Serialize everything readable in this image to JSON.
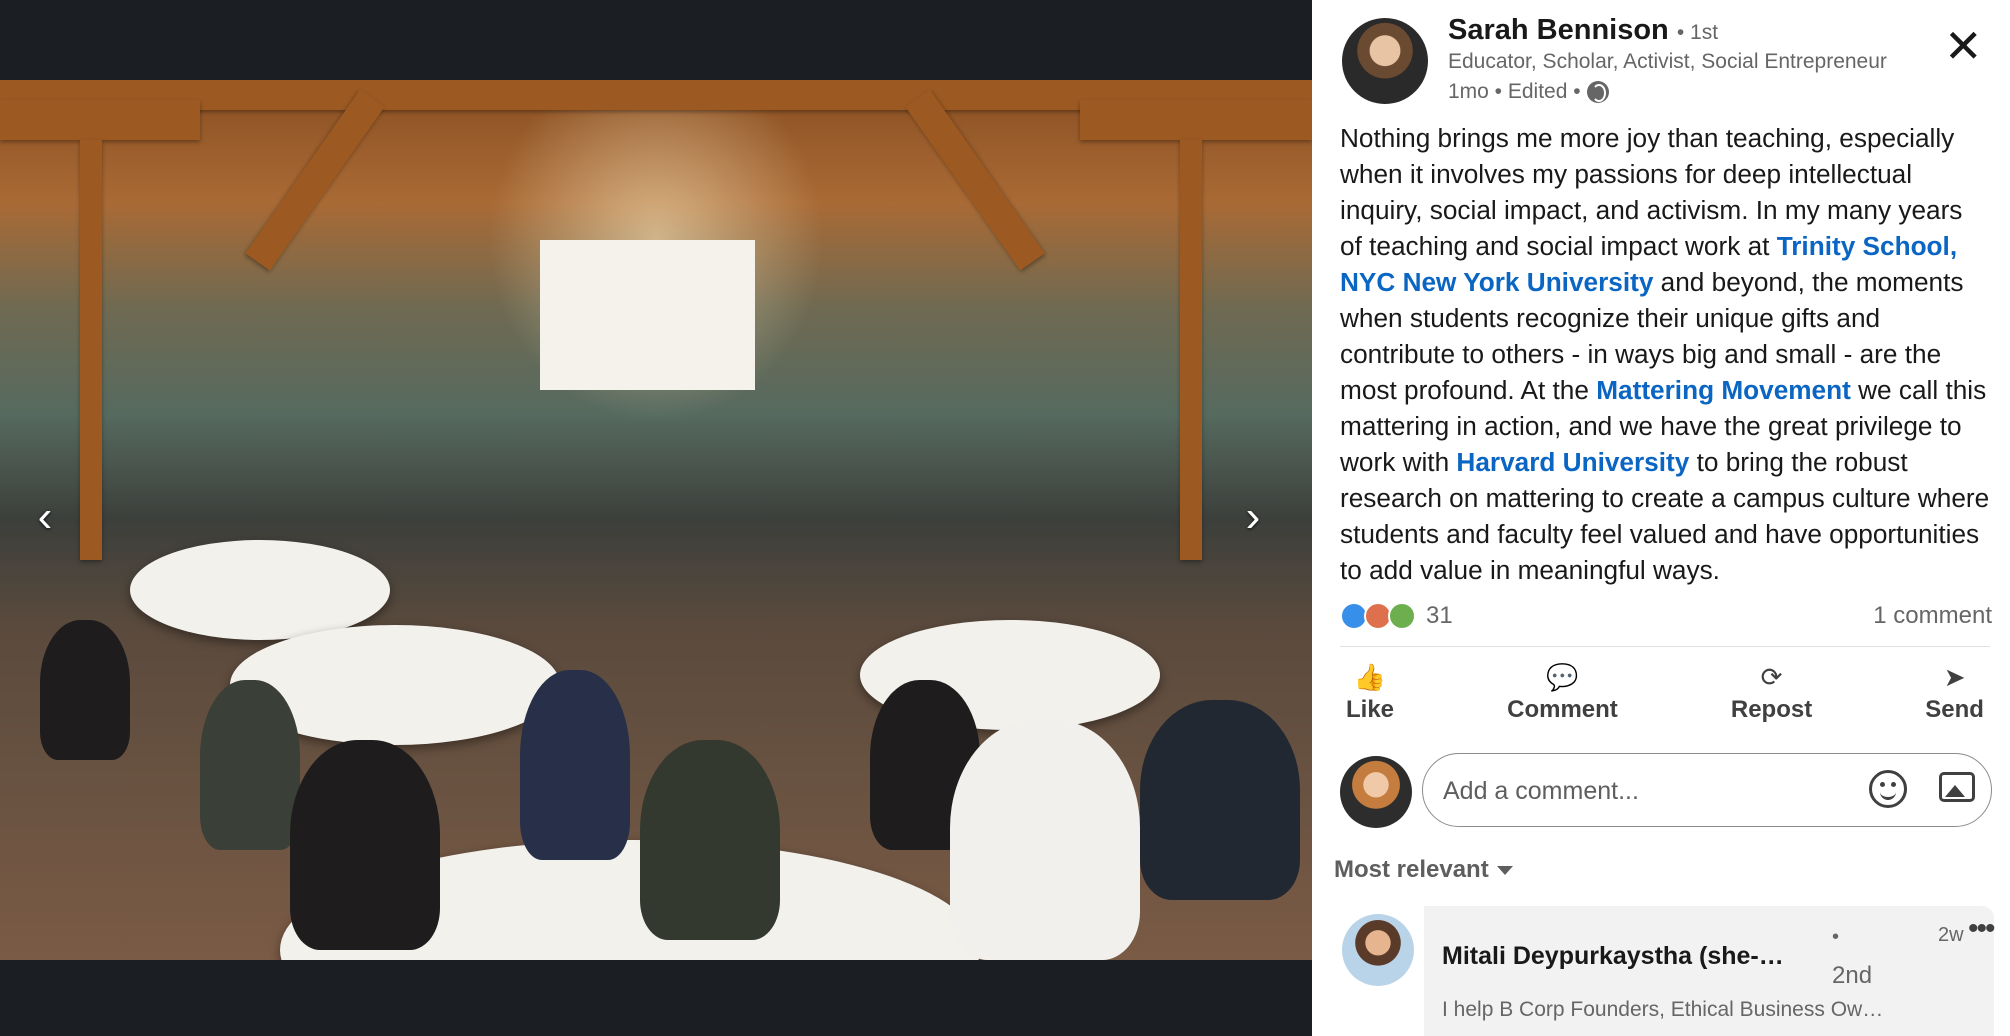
{
  "photo": {
    "prev_arrow": "‹",
    "next_arrow": "›"
  },
  "post": {
    "author": {
      "name": "Sarah Bennison",
      "degree": "• 1st",
      "headline": "Educator, Scholar, Activist, Social Entrepreneur",
      "meta": "1mo • Edited •"
    },
    "close_icon": "✕",
    "body": {
      "p1": "Nothing brings me more joy than teaching, especially when it involves my passions for deep intellectual inquiry, social impact, and activism. In my many years of teaching and social impact work at ",
      "link1": "Trinity School, NYC",
      "sep1": " ",
      "link2": "New York University",
      "p2": " and beyond, the moments when students recognize their unique gifts and contribute to others - in ways big and small - are the most profound. At the ",
      "link3": "Mattering Movement",
      "p3": " we call this mattering in action, and we have the great privilege to work with ",
      "link4": "Harvard University",
      "p4": " to bring the robust research on mattering to create a campus culture where students and faculty feel valued and have opportunities to add value in meaningful ways."
    },
    "reaction_count": "31",
    "comment_count": "1 comment",
    "actions": {
      "like": "Like",
      "comment": "Comment",
      "repost": "Repost",
      "send": "Send"
    },
    "comment_input": {
      "placeholder": "Add a comment..."
    },
    "sort_label": "Most relevant"
  },
  "comments": [
    {
      "name": "Mitali Deypurkaystha (she-…",
      "dot": "•",
      "degree": "2nd",
      "time": "2w",
      "more": "•••",
      "headline": "I help B Corp Founders, Ethical Business Owners"
    }
  ],
  "colors": {
    "link": "#0a66c2",
    "like": "#378fe9",
    "love": "#df704d",
    "support": "#6dae4f"
  }
}
